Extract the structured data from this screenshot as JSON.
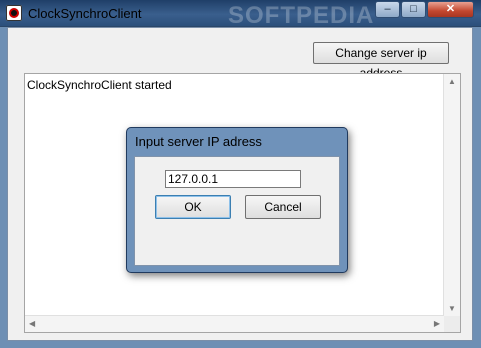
{
  "window": {
    "title": "ClockSynchroClient",
    "watermark": "SOFTPEDIA",
    "minimize_glyph": "–",
    "maximize_glyph": "□",
    "close_glyph": "✕"
  },
  "main": {
    "change_button_label": "Change server ip address",
    "log_lines": [
      "ClockSynchroClient started"
    ]
  },
  "dialog": {
    "title": "Input server IP adress",
    "ip_value": "127.0.0.1",
    "ok_label": "OK",
    "cancel_label": "Cancel"
  },
  "icons": {
    "app": "clock-app-icon",
    "scroll_up": "▲",
    "scroll_down": "▼",
    "scroll_left": "◀",
    "scroll_right": "▶"
  },
  "colors": {
    "titlebar": "#2b4f7b",
    "close_button": "#c3472f",
    "window_body": "#f0f0f0",
    "dialog_frame": "#6f92ba"
  }
}
